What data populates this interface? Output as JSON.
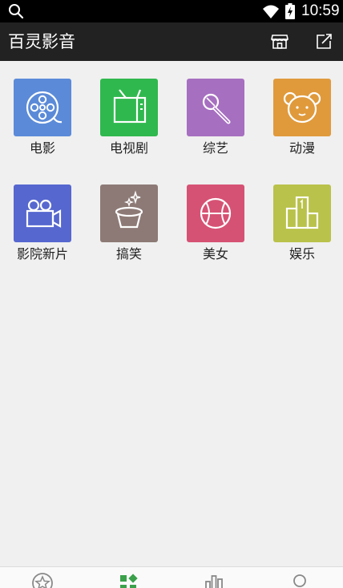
{
  "status_bar": {
    "time": "10:59"
  },
  "header": {
    "title": "百灵影音"
  },
  "colors": {
    "header_bg": "#222222",
    "accent_green": "#3aa14a",
    "movie": "#5b8bd8",
    "tv": "#2fb84e",
    "variety": "#a66fc0",
    "anime": "#e09a3c",
    "cinema": "#5667cf",
    "comedy": "#8d7a76",
    "beauty": "#d65274",
    "entertainment": "#b9c24a"
  },
  "categories": [
    {
      "label": "电影",
      "icon": "film-reel-icon"
    },
    {
      "label": "电视剧",
      "icon": "tv-icon"
    },
    {
      "label": "综艺",
      "icon": "microphone-icon"
    },
    {
      "label": "动漫",
      "icon": "bear-icon"
    },
    {
      "label": "影院新片",
      "icon": "video-camera-icon"
    },
    {
      "label": "搞笑",
      "icon": "magic-hat-icon"
    },
    {
      "label": "美女",
      "icon": "ball-icon"
    },
    {
      "label": "娱乐",
      "icon": "podium-icon"
    }
  ],
  "bottom_nav": {
    "items": [
      {
        "icon": "star-icon",
        "active": false
      },
      {
        "icon": "category-grid-icon",
        "active": true
      },
      {
        "icon": "bar-chart-icon",
        "active": false
      },
      {
        "icon": "user-icon",
        "active": false
      }
    ]
  }
}
